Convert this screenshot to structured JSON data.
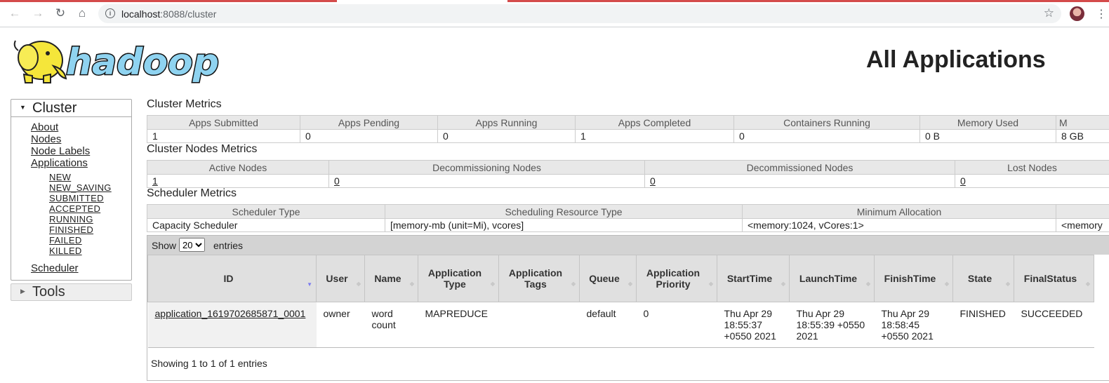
{
  "browser": {
    "url_host": "localhost",
    "url_rest": ":8088/cluster",
    "icons": [
      "back-icon",
      "forward-icon",
      "reload-icon",
      "home-icon",
      "info-icon",
      "star-icon",
      "profile-avatar",
      "menu-icon"
    ]
  },
  "header": {
    "logo_text": "hadoop",
    "title": "All Applications"
  },
  "sidebar": {
    "cluster": {
      "title": "Cluster",
      "links": [
        "About",
        "Nodes",
        "Node Labels",
        "Applications"
      ],
      "states": [
        "NEW",
        "NEW_SAVING",
        "SUBMITTED",
        "ACCEPTED",
        "RUNNING",
        "FINISHED",
        "FAILED",
        "KILLED"
      ],
      "scheduler": "Scheduler"
    },
    "tools": {
      "title": "Tools"
    }
  },
  "cluster_metrics": {
    "title": "Cluster Metrics",
    "headers": [
      "Apps Submitted",
      "Apps Pending",
      "Apps Running",
      "Apps Completed",
      "Containers Running",
      "Memory Used",
      "M"
    ],
    "values": [
      "1",
      "0",
      "0",
      "1",
      "0",
      "0 B",
      "8 GB"
    ]
  },
  "node_metrics": {
    "title": "Cluster Nodes Metrics",
    "headers": [
      "Active Nodes",
      "Decommissioning Nodes",
      "Decommissioned Nodes",
      "Lost Nodes"
    ],
    "values": [
      "1",
      "0",
      "0",
      "0"
    ]
  },
  "scheduler_metrics": {
    "title": "Scheduler Metrics",
    "headers": [
      "Scheduler Type",
      "Scheduling Resource Type",
      "Minimum Allocation",
      ""
    ],
    "values": [
      "Capacity Scheduler",
      "[memory-mb (unit=Mi), vcores]",
      "<memory:1024, vCores:1>",
      "<memory"
    ]
  },
  "apps": {
    "show_label": "Show",
    "page_size": "20",
    "entries_label": "entries",
    "columns": [
      "ID",
      "User",
      "Name",
      "Application Type",
      "Application Tags",
      "Queue",
      "Application Priority",
      "StartTime",
      "LaunchTime",
      "FinishTime",
      "State",
      "FinalStatus"
    ],
    "rows": [
      {
        "id": "application_1619702685871_0001",
        "user": "owner",
        "name": "word count",
        "type": "MAPREDUCE",
        "tags": "",
        "queue": "default",
        "priority": "0",
        "start": "Thu Apr 29 18:55:37 +0550 2021",
        "launch": "Thu Apr 29 18:55:39 +0550 2021",
        "finish": "Thu Apr 29 18:58:45 +0550 2021",
        "state": "FINISHED",
        "final_status": "SUCCEEDED"
      }
    ],
    "footer": "Showing 1 to 1 of 1 entries"
  }
}
